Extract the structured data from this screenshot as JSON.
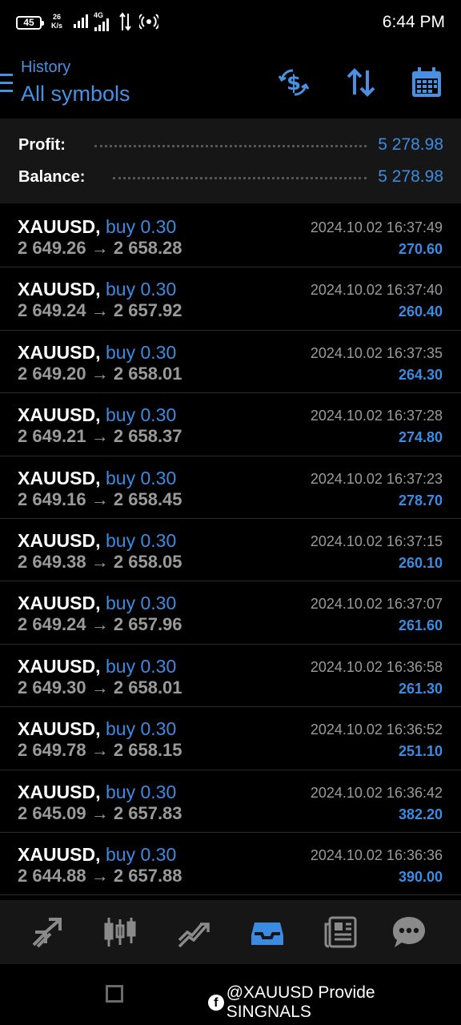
{
  "status_bar": {
    "battery": "45",
    "net_speed_value": "26",
    "net_speed_unit": "K/s",
    "network": "4G",
    "time": "6:44 PM"
  },
  "header": {
    "subtitle": "History",
    "title": "All symbols",
    "icons": [
      "menu-icon",
      "currency-exchange-icon",
      "sort-icon",
      "calendar-icon"
    ]
  },
  "summary": {
    "profit_label": "Profit:",
    "profit_value": "5 278.98",
    "balance_label": "Balance:",
    "balance_value": "5 278.98"
  },
  "deals": [
    {
      "symbol": "XAUUSD,",
      "side": "buy 0.30",
      "open": "2 649.26",
      "close": "2 658.28",
      "time": "2024.10.02 16:37:49",
      "profit": "270.60"
    },
    {
      "symbol": "XAUUSD,",
      "side": "buy 0.30",
      "open": "2 649.24",
      "close": "2 657.92",
      "time": "2024.10.02 16:37:40",
      "profit": "260.40"
    },
    {
      "symbol": "XAUUSD,",
      "side": "buy 0.30",
      "open": "2 649.20",
      "close": "2 658.01",
      "time": "2024.10.02 16:37:35",
      "profit": "264.30"
    },
    {
      "symbol": "XAUUSD,",
      "side": "buy 0.30",
      "open": "2 649.21",
      "close": "2 658.37",
      "time": "2024.10.02 16:37:28",
      "profit": "274.80"
    },
    {
      "symbol": "XAUUSD,",
      "side": "buy 0.30",
      "open": "2 649.16",
      "close": "2 658.45",
      "time": "2024.10.02 16:37:23",
      "profit": "278.70"
    },
    {
      "symbol": "XAUUSD,",
      "side": "buy 0.30",
      "open": "2 649.38",
      "close": "2 658.05",
      "time": "2024.10.02 16:37:15",
      "profit": "260.10"
    },
    {
      "symbol": "XAUUSD,",
      "side": "buy 0.30",
      "open": "2 649.24",
      "close": "2 657.96",
      "time": "2024.10.02 16:37:07",
      "profit": "261.60"
    },
    {
      "symbol": "XAUUSD,",
      "side": "buy 0.30",
      "open": "2 649.30",
      "close": "2 658.01",
      "time": "2024.10.02 16:36:58",
      "profit": "261.30"
    },
    {
      "symbol": "XAUUSD,",
      "side": "buy 0.30",
      "open": "2 649.78",
      "close": "2 658.15",
      "time": "2024.10.02 16:36:52",
      "profit": "251.10"
    },
    {
      "symbol": "XAUUSD,",
      "side": "buy 0.30",
      "open": "2 645.09",
      "close": "2 657.83",
      "time": "2024.10.02 16:36:42",
      "profit": "382.20"
    },
    {
      "symbol": "XAUUSD,",
      "side": "buy 0.30",
      "open": "2 644.88",
      "close": "2 657.88",
      "time": "2024.10.02 16:36:36",
      "profit": "390.00"
    }
  ],
  "price_arrow": "→",
  "bottom_nav": [
    "quotes-icon",
    "chart-icon",
    "trade-icon",
    "history-icon",
    "news-icon",
    "chat-icon"
  ],
  "active_nav": "history-icon",
  "watermark": "@XAUUSD Provide SINGNALS",
  "colors": {
    "accent": "#3d8be0",
    "header_accent": "#4a90e2",
    "background": "#000000",
    "panel": "#161616",
    "muted_text": "#9a9a9a"
  }
}
